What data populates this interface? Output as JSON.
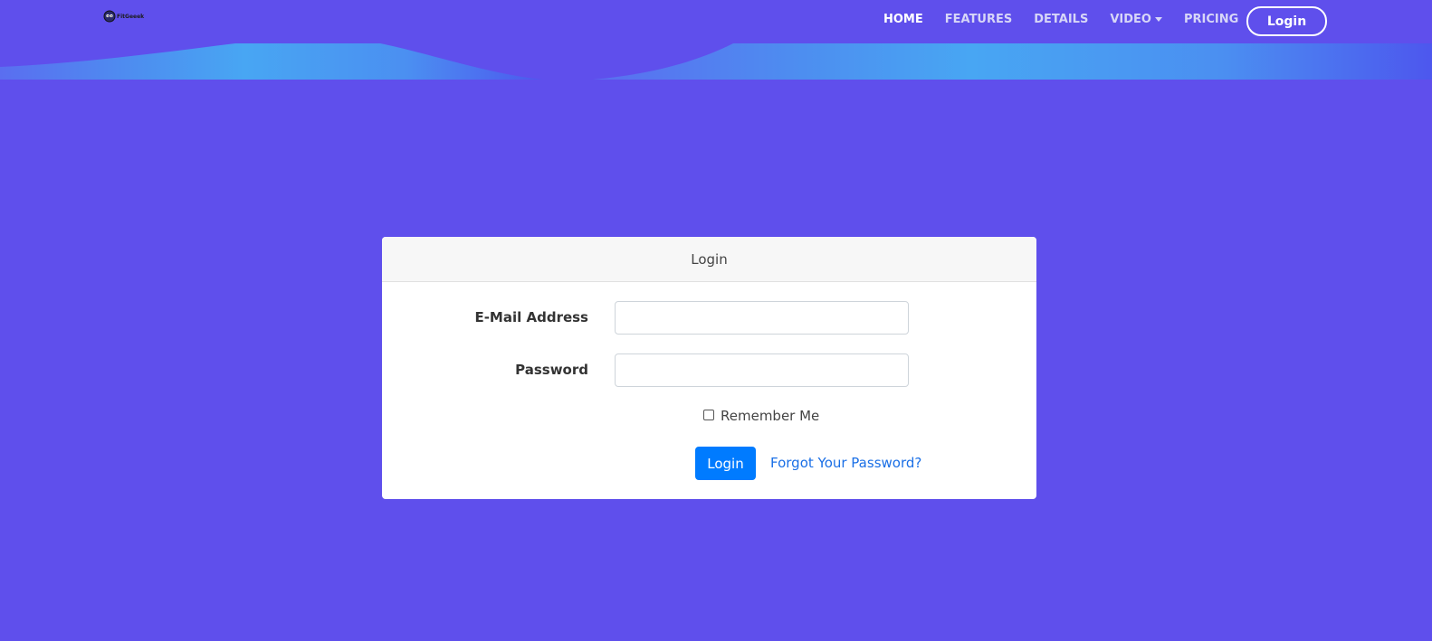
{
  "brand": {
    "logo_text": "FitGeeek",
    "logo_icon": "cloud-eyes-icon"
  },
  "nav": {
    "items": [
      {
        "label": "HOME",
        "active": true
      },
      {
        "label": "FEATURES",
        "active": false
      },
      {
        "label": "DETAILS",
        "active": false
      },
      {
        "label": "VIDEO",
        "active": false,
        "dropdown": true
      },
      {
        "label": "PRICING",
        "active": false
      }
    ],
    "login_button": "Login"
  },
  "colors": {
    "background": "#5f4fec",
    "wave_light": "#4aa8f2",
    "primary_button": "#007bff",
    "link": "#1a6fe6"
  },
  "login_card": {
    "title": "Login",
    "email_label": "E-Mail Address",
    "email_value": "",
    "password_label": "Password",
    "password_value": "",
    "remember_label": "Remember Me",
    "remember_checked": false,
    "submit_label": "Login",
    "forgot_label": "Forgot Your Password?"
  }
}
